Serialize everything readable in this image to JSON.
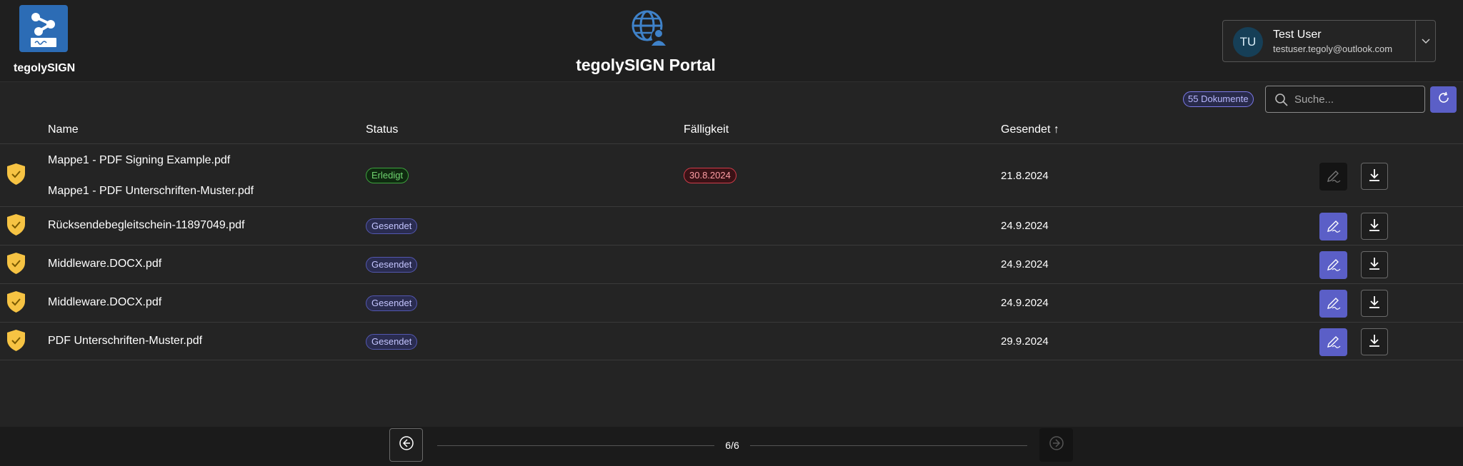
{
  "app": {
    "name": "tegolySIGN",
    "portal_title": "tegolySIGN Portal"
  },
  "user": {
    "initials": "TU",
    "name": "Test User",
    "email": "testuser.tegoly@outlook.com"
  },
  "toolbar": {
    "doc_count": "55 Dokumente",
    "search_placeholder": "Suche..."
  },
  "table": {
    "headers": {
      "name": "Name",
      "status": "Status",
      "due": "Fälligkeit",
      "sent": "Gesendet ↑"
    },
    "rows": [
      {
        "names": [
          "Mappe1 - PDF Signing Example.pdf",
          "Mappe1 - PDF Unterschriften-Muster.pdf"
        ],
        "status": "Erledigt",
        "due": "30.8.2024",
        "sent": "21.8.2024"
      },
      {
        "names": [
          "Rücksendebegleitschein-11897049.pdf"
        ],
        "status": "Gesendet",
        "due": "",
        "sent": "24.9.2024"
      },
      {
        "names": [
          "Middleware.DOCX.pdf"
        ],
        "status": "Gesendet",
        "due": "",
        "sent": "24.9.2024"
      },
      {
        "names": [
          "Middleware.DOCX.pdf"
        ],
        "status": "Gesendet",
        "due": "",
        "sent": "24.9.2024"
      },
      {
        "names": [
          "PDF Unterschriften-Muster.pdf"
        ],
        "status": "Gesendet",
        "due": "",
        "sent": "29.9.2024"
      }
    ]
  },
  "pagination": {
    "label": "6/6"
  },
  "colors": {
    "accent": "#5b5fc7",
    "shield": "#f6c343",
    "status_done": "#3da43d",
    "status_sent": "#5357b0",
    "overdue": "#d23c4a"
  },
  "icons": [
    "app-logo-icon",
    "globe-user-icon",
    "chevron-down-icon",
    "search-icon",
    "refresh-icon",
    "shield-check-icon",
    "signature-icon",
    "download-icon",
    "arrow-left-icon",
    "arrow-right-icon"
  ]
}
